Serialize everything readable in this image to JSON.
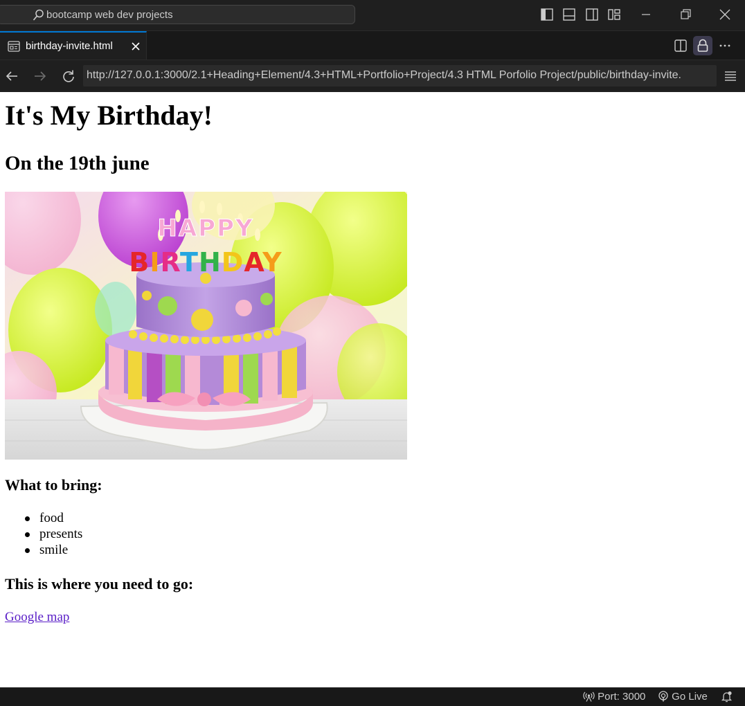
{
  "titlebar": {
    "command_center_text": "bootcamp web dev projects"
  },
  "tabs": [
    {
      "label": "birthday-invite.html"
    }
  ],
  "browser": {
    "url": "http://127.0.0.1:3000/2.1+Heading+Element/4.3+HTML+Portfolio+Project/4.3 HTML Porfolio Project/public/birthday-invite."
  },
  "page": {
    "heading": "It's My Birthday!",
    "subheading": "On the 19th june",
    "cake_image_lettering": [
      "HAPPY",
      "BIRTHDAY"
    ],
    "bring_heading": "What to bring:",
    "bring_items": [
      "food",
      "presents",
      "smile"
    ],
    "go_heading": "This is where you need to go:",
    "map_link": "Google map"
  },
  "statusbar": {
    "port": "Port: 3000",
    "go_live": "Go Live"
  },
  "colors": {
    "accent": "#0078d4",
    "link": "#5a1ec7",
    "chrome_bg": "#1f1f1f"
  }
}
